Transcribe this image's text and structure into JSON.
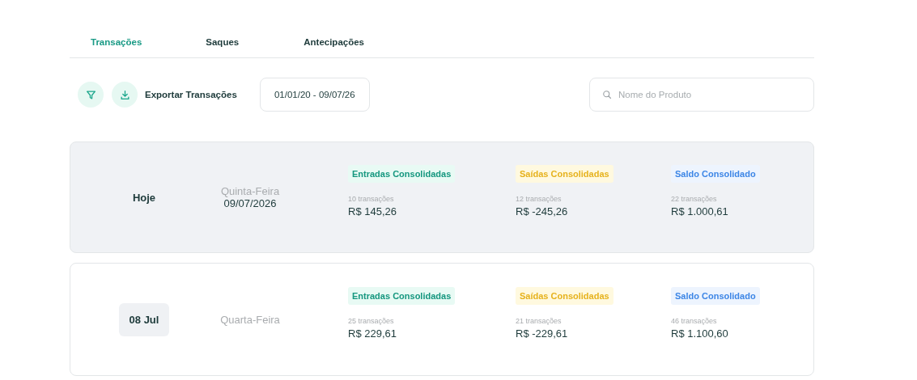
{
  "tabs": [
    {
      "label": "Transações",
      "selected": true
    },
    {
      "label": "Saques",
      "selected": false
    },
    {
      "label": "Antecipações",
      "selected": false
    }
  ],
  "toolbar": {
    "export_label": "Exportar Transações",
    "date_range": "01/01/20 - 09/07/26",
    "search": {
      "placeholder": "Nome do Produto"
    }
  },
  "days": [
    {
      "kind": "today",
      "label": "Hoje",
      "weekday": "Quinta-Feira",
      "date": "09/07/2026",
      "summaries": [
        {
          "kind": "in",
          "label": "Entradas Consolidadas",
          "count": "10 transações",
          "amount": "R$ 145,26"
        },
        {
          "kind": "out",
          "label": "Saídas Consolidadas",
          "count": "12 transações",
          "amount": "R$ -245,26"
        },
        {
          "kind": "balance",
          "label": "Saldo Consolidado",
          "count": "22 transações",
          "amount": "R$ 1.000,61"
        }
      ]
    },
    {
      "kind": "day",
      "label": "08 Jul",
      "weekday": "Quarta-Feira",
      "summaries": [
        {
          "kind": "in",
          "label": "Entradas Consolidadas",
          "count": "25 transações",
          "amount": "R$ 229,61"
        },
        {
          "kind": "out",
          "label": "Saídas Consolidadas",
          "count": "21 transações",
          "amount": "R$ -229,61"
        },
        {
          "kind": "balance",
          "label": "Saldo Consolidado",
          "count": "46 transações",
          "amount": "R$ 1.100,60"
        }
      ]
    }
  ]
}
